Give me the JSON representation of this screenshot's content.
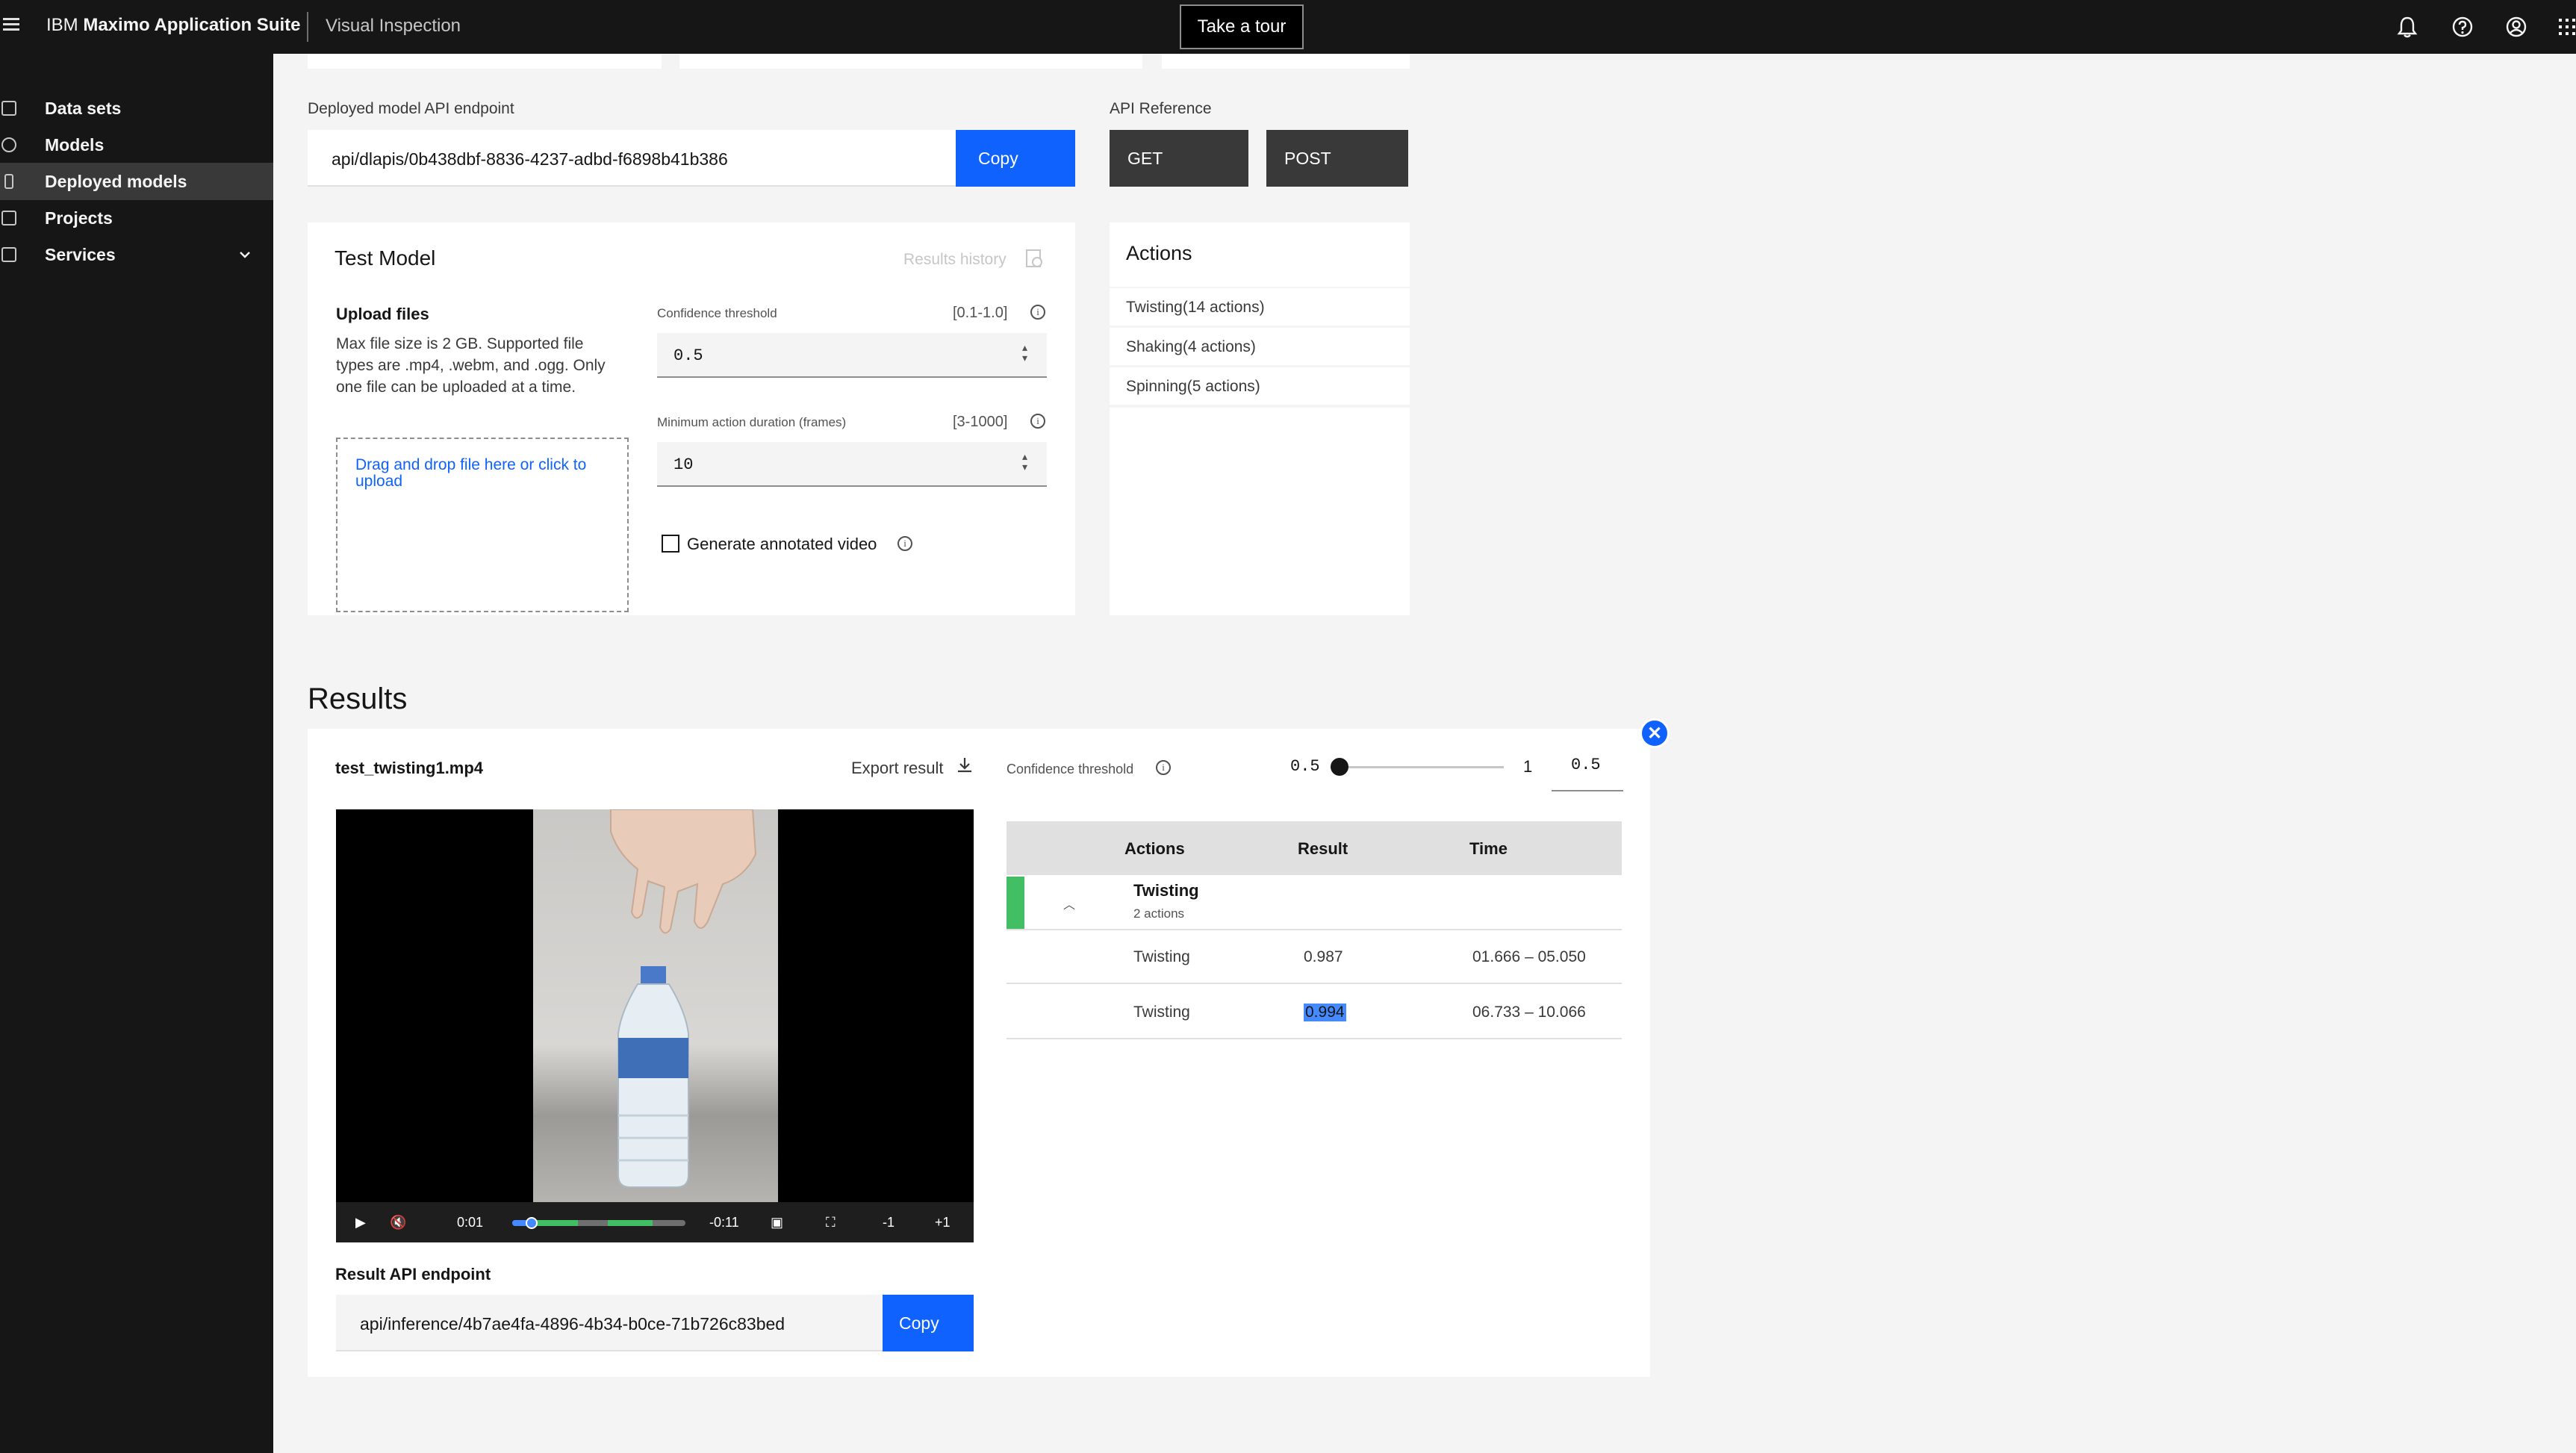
{
  "header": {
    "brand_prefix": "IBM",
    "brand_name": "Maximo Application Suite",
    "product": "Visual Inspection",
    "tour_button": "Take a tour",
    "icons": [
      "bell-icon",
      "help-icon",
      "user-icon",
      "app-switcher-icon"
    ]
  },
  "sidebar": {
    "items": [
      {
        "label": "Data sets",
        "icon": "data-sets-icon",
        "active": false
      },
      {
        "label": "Models",
        "icon": "models-icon",
        "active": false
      },
      {
        "label": "Deployed models",
        "icon": "deployed-models-icon",
        "active": true
      },
      {
        "label": "Projects",
        "icon": "projects-icon",
        "active": false
      },
      {
        "label": "Services",
        "icon": "services-icon",
        "active": false,
        "expandable": true
      }
    ]
  },
  "endpoint": {
    "label": "Deployed model API endpoint",
    "value": "api/dlapis/0b438dbf-8836-4237-adbd-f6898b41b386",
    "copy_label": "Copy"
  },
  "api_reference": {
    "label": "API Reference",
    "get_label": "GET",
    "post_label": "POST"
  },
  "test_model": {
    "title": "Test Model",
    "results_history": "Results history",
    "upload_title": "Upload files",
    "upload_desc": "Max file size is 2 GB. Supported file types are .mp4, .webm, and .ogg. Only one file can be uploaded at a time.",
    "dropzone_text": "Drag and drop file here or click to upload",
    "confidence_label": "Confidence threshold",
    "confidence_range": "[0.1-1.0]",
    "confidence_value": "0.5",
    "min_duration_label": "Minimum action duration (frames)",
    "min_duration_range": "[3-1000]",
    "min_duration_value": "10",
    "annotated_label": "Generate annotated video",
    "annotated_checked": false
  },
  "actions_panel": {
    "title": "Actions",
    "items": [
      "Twisting(14 actions)",
      "Shaking(4 actions)",
      "Spinning(5 actions)"
    ]
  },
  "results": {
    "title": "Results",
    "file_name": "test_twisting1.mp4",
    "export_label": "Export result",
    "confidence_label": "Confidence threshold",
    "slider_min": "0.5",
    "slider_max": "1",
    "slider_value": "0.5",
    "video": {
      "current_time": "0:01",
      "remaining_time": "-0:11",
      "skip_back": "-1",
      "skip_forward": "+1",
      "progress": 0.13
    },
    "table": {
      "headers": [
        "Actions",
        "Result",
        "Time"
      ],
      "group": {
        "name": "Twisting",
        "count": "2 actions",
        "color": "#42be65"
      },
      "rows": [
        {
          "action": "Twisting",
          "result": "0.987",
          "time": "01.666 – 05.050"
        },
        {
          "action": "Twisting",
          "result": "0.994",
          "time": "06.733 – 10.066"
        }
      ]
    },
    "result_api_label": "Result API endpoint",
    "result_api_value": "api/inference/4b7ae4fa-4896-4b34-b0ce-71b726c83bed",
    "copy_label": "Copy"
  },
  "colors": {
    "accent": "#0f62fe",
    "shell": "#161616",
    "success": "#42be65"
  }
}
